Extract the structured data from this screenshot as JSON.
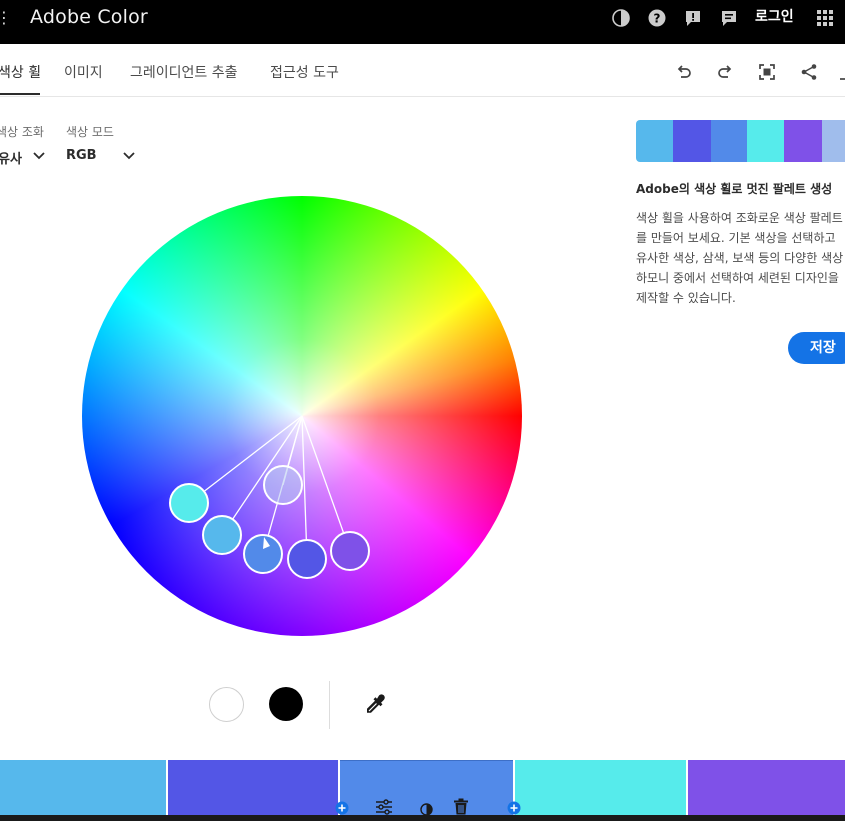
{
  "app": {
    "title": "Adobe Color",
    "login_label": "로그인"
  },
  "tabs": [
    {
      "label": "색상 휠"
    },
    {
      "label": "이미지"
    },
    {
      "label": "그레이디언트 추출"
    },
    {
      "label": "접근성 도구"
    }
  ],
  "controls": {
    "harmony": {
      "label": "색상 조화",
      "value": "유사"
    },
    "mode": {
      "label": "색상 모드",
      "value": "RGB"
    }
  },
  "palette": {
    "colors": [
      "#56b8ec",
      "#5356e6",
      "#528ae9",
      "#56ebeb",
      "#7f51e8",
      "#a0bdec"
    ]
  },
  "panel": {
    "title": "Adobe의 색상 휠로 멋진 팔레트 생성",
    "desc_lines": [
      "색상 휠을 사용하여 조화로운 색상 팔레트",
      "를 만들어 보세요. 기본 색상을 선택하고",
      "유사한 색상, 삼색, 보색 등의 다양한 색상",
      "하모니 중에서 선택하여 세련된 디자인을",
      "제작할 수 있습니다."
    ],
    "save_label": "저장"
  },
  "bottom_swatches": [
    "#56b8ec",
    "#5356e6",
    "#528ae9",
    "#56ebeb",
    "#7f51e8"
  ],
  "icons": {
    "menu": "menu-icon",
    "theme": "contrast-icon",
    "help": "help-icon",
    "feedback": "feedback-icon",
    "chat": "chat-icon",
    "apps": "apps-grid-icon",
    "undo": "undo-icon",
    "redo": "redo-icon",
    "fullscreen": "fullscreen-icon",
    "share": "share-icon",
    "eyedropper": "eyedropper-icon",
    "adjust": "sliders-icon",
    "contrast": "contrast-icon",
    "delete": "trash-icon",
    "add": "plus-icon"
  }
}
